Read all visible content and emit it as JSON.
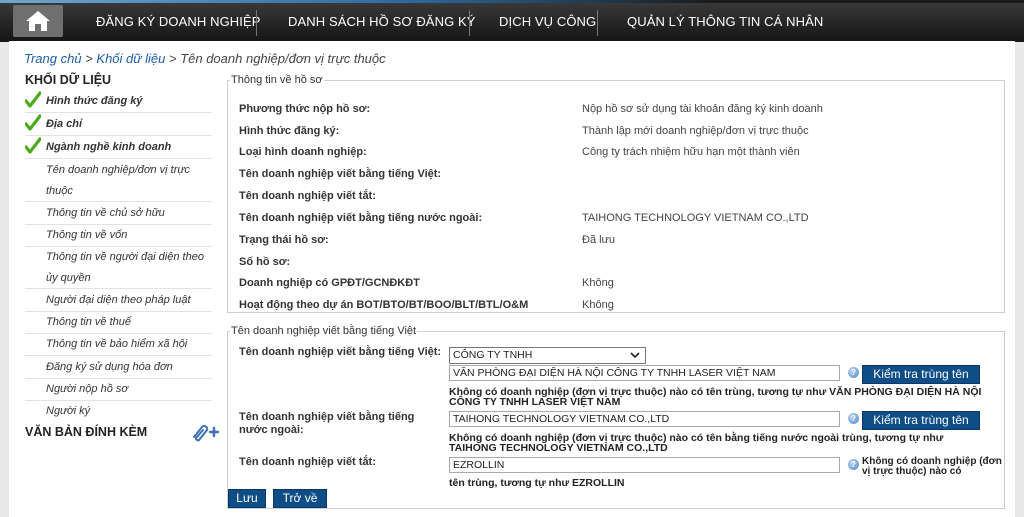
{
  "nav": {
    "items": [
      "ĐĂNG KÝ DOANH NGHIỆP",
      "DANH SÁCH HỒ SƠ ĐĂNG KÝ",
      "DỊCH VỤ CÔNG",
      "QUẢN LÝ THÔNG TIN CÁ NHÂN"
    ]
  },
  "breadcrumb": {
    "home": "Trang chủ",
    "sep1": " > ",
    "section": "Khối dữ liệu",
    "sep2": " > ",
    "current": "Tên doanh nghiệp/đơn vị trực thuộc"
  },
  "sidebar": {
    "title": "KHỐI DỮ LIỆU",
    "items": [
      {
        "label": "Hình thức đăng ký",
        "done": true
      },
      {
        "label": "Địa chỉ",
        "done": true
      },
      {
        "label": "Ngành nghề kinh doanh",
        "done": true
      },
      {
        "label": "Tên doanh nghiệp/đơn vị trực thuộc",
        "done": false
      },
      {
        "label": "Thông tin về chủ sở hữu",
        "done": false
      },
      {
        "label": "Thông tin về vốn",
        "done": false
      },
      {
        "label": "Thông tin về người đại diện theo ủy quyền",
        "done": false
      },
      {
        "label": "Người đại diện theo pháp luật",
        "done": false
      },
      {
        "label": "Thông tin về thuế",
        "done": false
      },
      {
        "label": "Thông tin về bảo hiểm xã hội",
        "done": false
      },
      {
        "label": "Đăng ký sử dụng hóa đơn",
        "done": false
      },
      {
        "label": "Người nộp hồ sơ",
        "done": false
      },
      {
        "label": "Người ký",
        "done": false
      }
    ],
    "attachments_title": "VĂN BẢN ĐÍNH KÈM"
  },
  "profile": {
    "legend": "Thông tin về hồ sơ",
    "rows": [
      {
        "label": "Phương thức nộp hồ sơ:",
        "value": "Nộp hồ sơ sử dụng tài khoản đăng ký kinh doanh"
      },
      {
        "label": "Hình thức đăng ký:",
        "value": "Thành lập mới doanh nghiệp/đơn vị trực thuộc"
      },
      {
        "label": "Loại hình doanh nghiệp:",
        "value": "Công ty trách nhiệm hữu hạn một thành viên"
      },
      {
        "label": "Tên doanh nghiệp viết bằng tiếng Việt:",
        "value": ""
      },
      {
        "label": "Tên doanh nghiệp viết tắt:",
        "value": ""
      },
      {
        "label": "Tên doanh nghiệp viết bằng tiếng nước ngoài:",
        "value": "TAIHONG TECHNOLOGY VIETNAM CO.,LTD"
      },
      {
        "label": "Trạng thái hồ sơ:",
        "value": "Đã lưu"
      },
      {
        "label": "Số hồ sơ:",
        "value": ""
      },
      {
        "label": "Doanh nghiệp có GPĐT/GCNĐKĐT",
        "value": "Không"
      },
      {
        "label": "Hoạt động theo dự án BOT/BTO/BT/BOO/BLT/BTL/O&M",
        "value": "Không"
      }
    ]
  },
  "name_form": {
    "legend": "Tên doanh nghiệp viết bằng tiếng Việt",
    "vn_label": "Tên doanh nghiệp viết bằng tiếng Việt:",
    "vn_type_selected": "CÔNG TY TNHH",
    "vn_name_value": "VĂN PHÒNG ĐẠI DIỆN HÀ NỘI CÔNG TY TNHH LASER VIỆT NAM",
    "check_button": "Kiểm tra trùng tên",
    "vn_message": "Không có doanh nghiệp (đơn vị trực thuộc) nào có tên trùng, tương tự như VĂN PHÒNG ĐẠI DIỆN HÀ NỘI CÔNG TY TNHH LASER VIỆT NAM",
    "foreign_label": "Tên doanh nghiệp viết bằng tiếng nước ngoài:",
    "foreign_value": "TAIHONG TECHNOLOGY VIETNAM CO.,LTD",
    "foreign_message": "Không có doanh nghiệp (đơn vị trực thuộc) nào có tên bằng tiếng nước ngoài trùng, tương tự như TAIHONG TECHNOLOGY VIETNAM CO.,LTD",
    "abbr_label": "Tên doanh nghiệp viết tắt:",
    "abbr_value": "EZROLLIN",
    "abbr_message_side": "Không có doanh nghiệp (đơn vị trực thuộc) nào có",
    "abbr_message_bottom": "tên trùng, tương tự như EZROLLIN",
    "help_glyph": "?"
  },
  "actions": {
    "save": "Lưu",
    "back": "Trở về"
  },
  "colors": {
    "nav_bg": "#1f1f1f",
    "button_blue": "#0f4d86",
    "link": "#1f5fa6",
    "check_green": "#4caa1e"
  }
}
